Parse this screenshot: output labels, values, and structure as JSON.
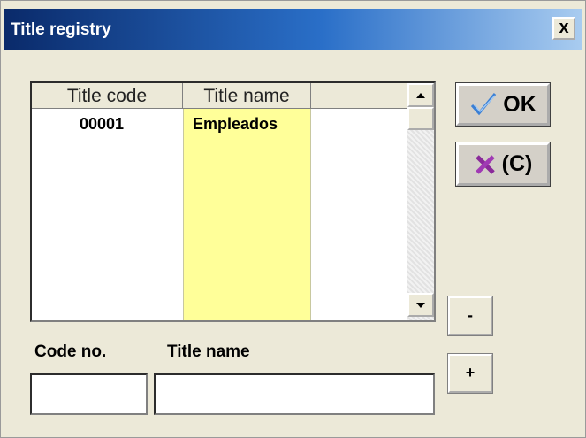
{
  "window": {
    "title": "Title registry",
    "close_label": "x"
  },
  "list": {
    "columns": [
      "Title code",
      "Title name",
      ""
    ],
    "rows": [
      {
        "code": "00001",
        "name": "Empleados"
      }
    ]
  },
  "buttons": {
    "ok_label": "OK",
    "cancel_label": "(C)",
    "minus_label": "-",
    "plus_label": "+"
  },
  "form": {
    "code_label": "Code no.",
    "name_label": "Title name",
    "code_value": "",
    "name_value": ""
  },
  "colors": {
    "selected_column": "#ffff99",
    "titlebar_start": "#0a2a6a",
    "titlebar_end": "#a9ccf0"
  },
  "icons": [
    "checkmark-icon",
    "cross-icon",
    "scroll-up-arrow-icon",
    "scroll-down-arrow-icon"
  ]
}
